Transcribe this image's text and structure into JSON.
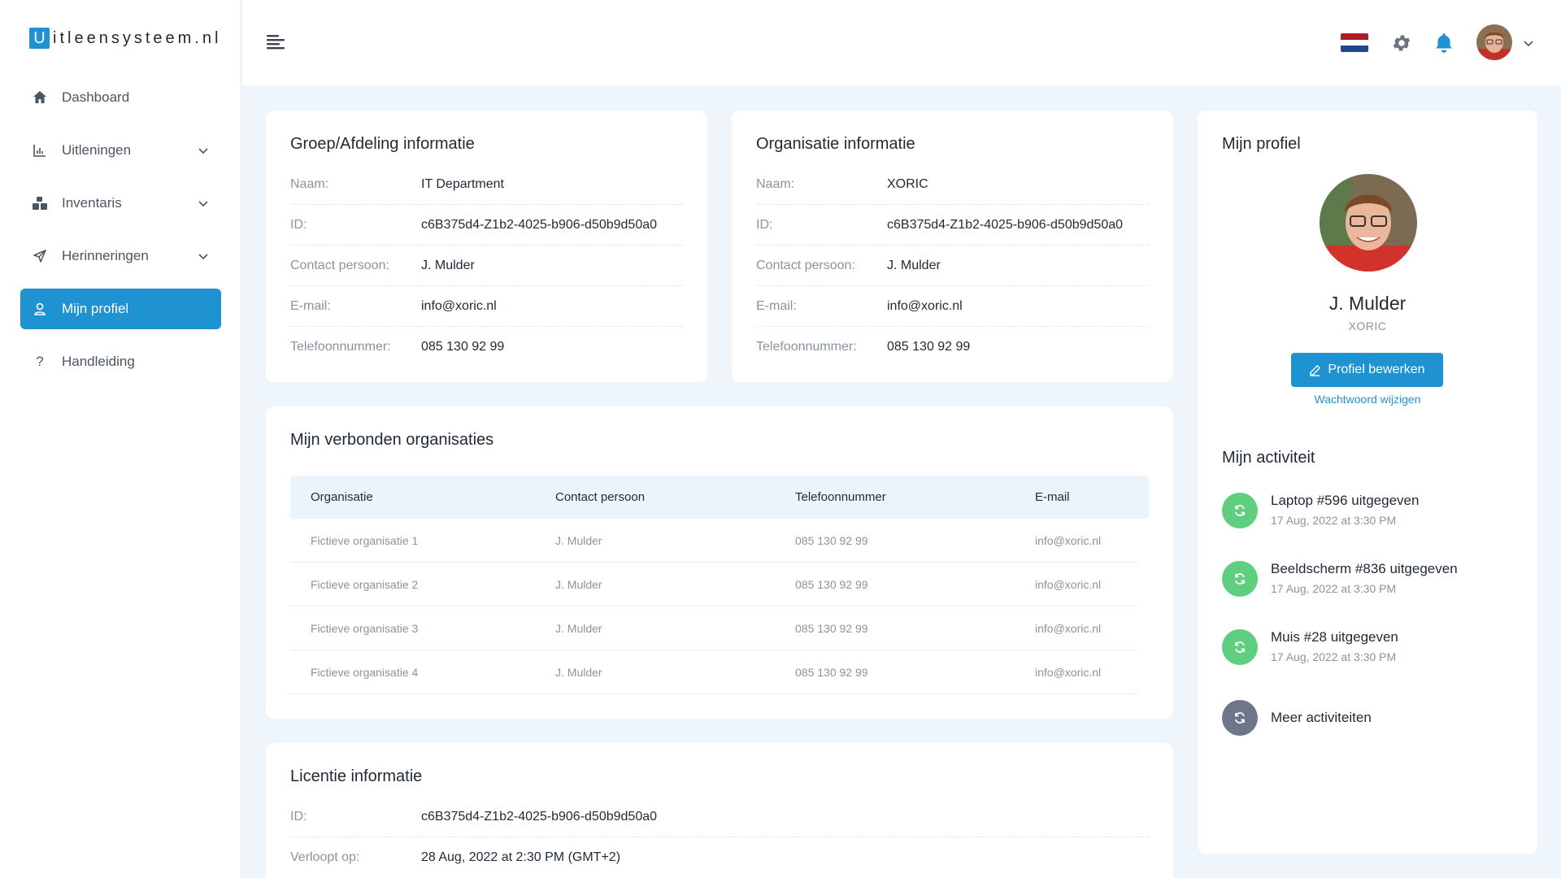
{
  "app": {
    "logo_letter": "U",
    "logo_rest": "itleensysteem.nl"
  },
  "sidebar": {
    "items": [
      {
        "label": "Dashboard",
        "icon": "home-icon"
      },
      {
        "label": "Uitleningen",
        "icon": "chart-icon"
      },
      {
        "label": "Inventaris",
        "icon": "boxes-icon"
      },
      {
        "label": "Herinneringen",
        "icon": "send-icon"
      },
      {
        "label": "Mijn profiel",
        "icon": "user-icon",
        "active": true
      },
      {
        "label": "Handleiding",
        "icon": "help-icon"
      }
    ]
  },
  "topbar": {
    "flag_colors": [
      "#ae1c28",
      "#ffffff",
      "#21468b"
    ],
    "accent": "#1f93d1"
  },
  "group": {
    "title": "Groep/Afdeling informatie",
    "rows": [
      {
        "label": "Naam:",
        "value": "IT Department"
      },
      {
        "label": "ID:",
        "value": "c6B375d4-Z1b2-4025-b906-d50b9d50a0"
      },
      {
        "label": "Contact persoon:",
        "value": "J. Mulder"
      },
      {
        "label": "E-mail:",
        "value": "info@xoric.nl"
      },
      {
        "label": "Telefoonnummer:",
        "value": "085 130 92 99"
      }
    ]
  },
  "organisation": {
    "title": "Organisatie informatie",
    "rows": [
      {
        "label": "Naam:",
        "value": "XORIC"
      },
      {
        "label": "ID:",
        "value": "c6B375d4-Z1b2-4025-b906-d50b9d50a0"
      },
      {
        "label": "Contact persoon:",
        "value": "J. Mulder"
      },
      {
        "label": "E-mail:",
        "value": "info@xoric.nl"
      },
      {
        "label": "Telefoonnummer:",
        "value": "085 130 92 99"
      }
    ]
  },
  "connected": {
    "title": "Mijn verbonden organisaties",
    "headers": [
      "Organisatie",
      "Contact persoon",
      "Telefoonnummer",
      "E-mail"
    ],
    "rows": [
      [
        "Fictieve organisatie 1",
        "J. Mulder",
        "085 130 92 99",
        "info@xoric.nl"
      ],
      [
        "Fictieve organisatie 2",
        "J. Mulder",
        "085 130 92 99",
        "info@xoric.nl"
      ],
      [
        "Fictieve organisatie 3",
        "J. Mulder",
        "085 130 92 99",
        "info@xoric.nl"
      ],
      [
        "Fictieve organisatie 4",
        "J. Mulder",
        "085 130 92 99",
        "info@xoric.nl"
      ]
    ]
  },
  "license": {
    "title": "Licentie informatie",
    "rows": [
      {
        "label": "ID:",
        "value": "c6B375d4-Z1b2-4025-b906-d50b9d50a0"
      },
      {
        "label": "Verloopt op:",
        "value": "28 Aug, 2022 at 2:30 PM (GMT+2)"
      }
    ]
  },
  "profile": {
    "title": "Mijn profiel",
    "name": "J. Mulder",
    "org": "XORIC",
    "edit_label": "Profiel bewerken",
    "password_link": "Wachtwoord wijzigen",
    "activity_title": "Mijn activiteit",
    "activities": [
      {
        "title": "Laptop #596 uitgegeven",
        "date": "17 Aug, 2022 at 3:30 PM"
      },
      {
        "title": "Beeldscherm #836 uitgegeven",
        "date": "17 Aug, 2022 at 3:30 PM"
      },
      {
        "title": "Muis #28 uitgegeven",
        "date": "17 Aug, 2022 at 3:30 PM"
      }
    ],
    "more_label": "Meer activiteiten"
  }
}
